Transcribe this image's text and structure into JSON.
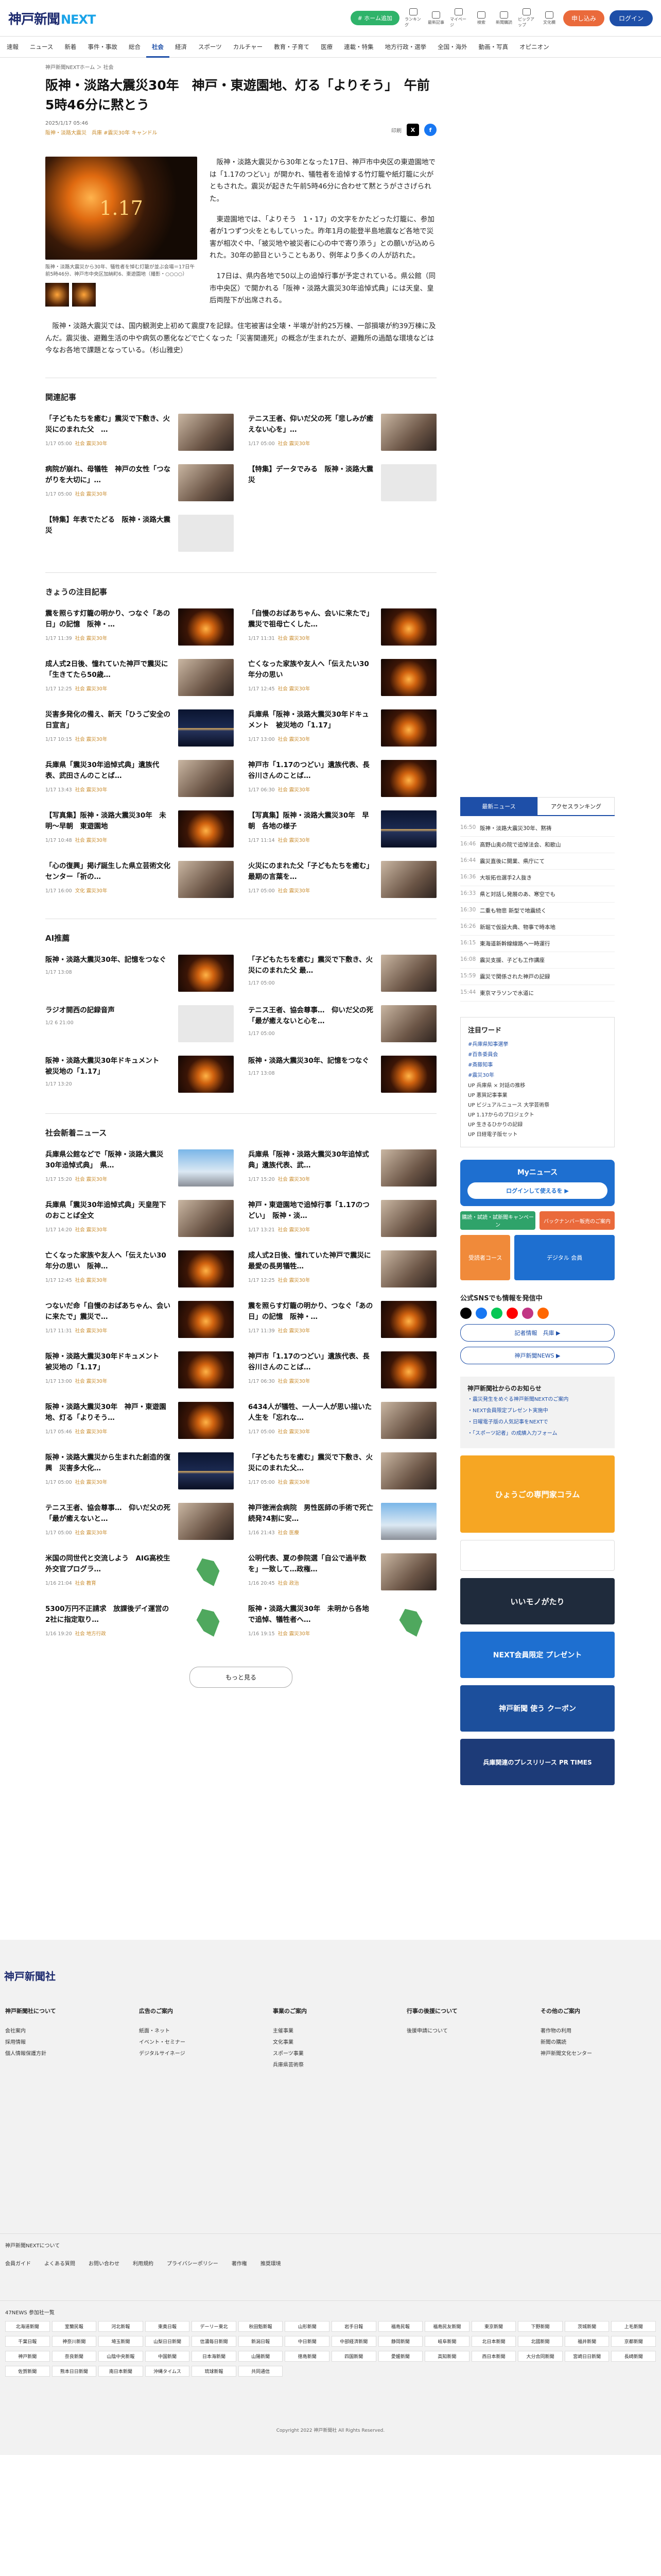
{
  "header": {
    "logo_main": "神戸新聞",
    "logo_next": "NEXT",
    "green_button": "# ホーム追加",
    "icons": [
      "ランキング",
      "最新記事",
      "マイページ"
    ],
    "icon2": [
      "検索",
      "新聞購読",
      "ピックアップ",
      "文化欄"
    ],
    "subscribe": "申し込み",
    "login": "ログイン"
  },
  "nav": [
    "速報",
    "ニュース",
    "新着",
    "事件・事故",
    "総合",
    "社会",
    "経済",
    "スポーツ",
    "カルチャー",
    "教育・子育て",
    "医療",
    "連載・特集",
    "地方行政・選挙",
    "全国・海外",
    "動画・写真",
    "オピニオン"
  ],
  "nav_active": "社会",
  "breadcrumb": "神戸新聞NEXTホーム ＞ 社会",
  "article": {
    "title": "阪神・淡路大震災30年　神戸・東遊園地、灯る「よりそう」　午前5時46分に黙とう",
    "date": "2025/1/17 05:46",
    "tags": "阪神・淡路大震災　兵庫 #震災30年 キャンドル",
    "print": "印刷",
    "caption": "阪神・淡路大震災から30年、犠牲者を悼む灯籠が並ぶ会場＝17日午前5時46分、神戸市中央区加納町6、東遊園地（撮影・○○○○）",
    "paras": [
      "阪神・淡路大震災から30年となった17日、神戸市中央区の東遊園地では「1.17のつどい」が開かれ、犠牲者を追悼する竹灯籠や紙灯籠に火がともされた。震災が起きた午前5時46分に合わせて黙とうがささげられた。",
      "東遊園地では、「よりそう　1・17」の文字をかたどった灯籠に、参加者が1つずつ火をともしていった。昨年1月の能登半島地震など各地で災害が相次ぐ中、「被災地や被災者に心の中で寄り添う」との願いが込められた。30年の節目ということもあり、例年より多くの人が訪れた。",
      "17日は、県内各地で50以上の追悼行事が予定されている。県公館（同市中央区）で開かれる「阪神・淡路大震災30年追悼式典」には天皇、皇后両陛下が出席される。"
    ],
    "full": "阪神・淡路大震災では、国内観測史上初めて震度7を記録。住宅被害は全壊・半壊が計約25万棟、一部損壊が約39万棟に及んだ。震災後、避難生活の中や病気の悪化などで亡くなった「災害関連死」の概念が生まれたが、避難所の過酷な環境などは今なお各地で課題となっている。（杉山雅史）"
  },
  "related": {
    "heading": "関連記事",
    "items": [
      {
        "t": "「子どもたちを癒む」震災で下敷き、火災にのまれた父　…",
        "m": "1/17 05:00",
        "c": "社会 震災30年",
        "img": "people"
      },
      {
        "t": "テニス王者、仰いだ父の死「悲しみが癒えない心を」…",
        "m": "1/17 05:00",
        "c": "社会 震災30年",
        "img": "people"
      },
      {
        "t": "病院が崩れ、母犠牲　神戸の女性「つながりを大切に」…",
        "m": "1/17 05:00",
        "c": "社会 震災30年",
        "img": "people"
      },
      {
        "t": "【特集】データでみる　阪神・淡路大震災",
        "m": "",
        "c": "",
        "img": "grey"
      },
      {
        "t": "【特集】年表でたどる　阪神・淡路大震災",
        "m": "",
        "c": "",
        "img": "grey"
      }
    ]
  },
  "today": {
    "heading": "きょうの注目記事",
    "items": [
      {
        "t": "震を照らす灯籠の明かり、つなぐ「あの日」の記憶　阪神・…",
        "m": "1/17 11:39",
        "c": "社会 震災30年",
        "img": "fire"
      },
      {
        "t": "「自慢のおばあちゃん、会いに来たで」震災で祖母亡くした…",
        "m": "1/17 11:31",
        "c": "社会 震災30年",
        "img": "fire"
      },
      {
        "t": "",
        "m": "",
        "c": "",
        "img": ""
      },
      {
        "t": "成人式2日後、憧れていた神戸で震災に「生きてたら50歳…",
        "m": "1/17 12:25",
        "c": "社会 震災30年",
        "img": "people"
      },
      {
        "t": "亡くなった家族や友人へ「伝えたい30年分の思い",
        "m": "1/17 12:45",
        "c": "社会 震災30年",
        "img": "fire"
      },
      {
        "t": "災害多発化の備え、新天「ひうご安全の日宣言」",
        "m": "1/17 10:15",
        "c": "社会 震災30年",
        "img": "night"
      },
      {
        "t": "兵庫県「阪神・淡路大震災30年ドキュメント　被災地の「1.17」",
        "m": "1/17 13:00",
        "c": "社会 震災30年",
        "img": "fire"
      },
      {
        "t": "兵庫県「震災30年追悼式典」遺族代表、武田さんのことば…",
        "m": "1/17 13:43",
        "c": "社会 震災30年",
        "img": "people"
      },
      {
        "t": "神戸市「1.17のつどい」遺族代表、長谷川さんのことば…",
        "m": "1/17 06:30",
        "c": "社会 震災30年",
        "img": "fire"
      },
      {
        "t": "【写真集】阪神・淡路大震災30年　未明～早朝　東遊園地",
        "m": "1/17 10:48",
        "c": "社会 震災30年",
        "img": "fire"
      },
      {
        "t": "【写真集】阪神・淡路大震災30年　早朝　各地の様子",
        "m": "1/17 11:14",
        "c": "社会 震災30年",
        "img": "night"
      },
      {
        "t": "",
        "m": "",
        "c": "",
        "img": ""
      },
      {
        "t": "「心の復興」掲げ誕生した県立芸術文化センター「祈の…",
        "m": "1/17 16:00",
        "c": "文化 震災30年",
        "img": "people"
      },
      {
        "t": "火災にのまれた父「子どもたちを癒む」　最期の言葉を…",
        "m": "1/17 05:00",
        "c": "社会 震災30年",
        "img": "people"
      }
    ]
  },
  "ai": {
    "heading": "AI推薦",
    "items": [
      {
        "t": "阪神・淡路大震災30年、記憶をつなぐ",
        "m": "1/17 13:08",
        "c": "",
        "img": "fire"
      },
      {
        "t": "「子どもたちを癒む」震災で下敷き、火災にのまれた父 最…",
        "m": "1/17 05:00",
        "c": "",
        "img": "people"
      },
      {
        "t": "ラジオ開西の記録音声",
        "m": "1/2 6 21:00",
        "c": "",
        "img": "grey"
      },
      {
        "t": "テニス王者、協会尊事…　仰いだ父の死「最が癒えないと心を…",
        "m": "1/17 05:00",
        "c": "",
        "img": "people"
      },
      {
        "t": "阪神・淡路大震災30年ドキュメント　被災地の「1.17」",
        "m": "1/17 13:20",
        "c": "",
        "img": "fire"
      },
      {
        "t": "阪神・淡路大震災30年、記憶をつなぐ",
        "m": "1/17 13:08",
        "c": "",
        "img": "fire"
      }
    ]
  },
  "social": {
    "heading": "社会新着ニュース",
    "items": [
      {
        "t": "兵庫県公館などで「阪神・淡路大震災30年追悼式典」　県…",
        "m": "1/17 15:20",
        "c": "社会 震災30年",
        "img": "blue"
      },
      {
        "t": "兵庫県「阪神・淡路大震災30年追悼式典」遺族代表、武…",
        "m": "1/17 15:20",
        "c": "社会 震災30年",
        "img": "people"
      },
      {
        "t": "",
        "m": "",
        "c": "",
        "img": ""
      },
      {
        "t": "兵庫県「震災30年追悼式典」天皇陛下のおことば全文",
        "m": "1/17 14:20",
        "c": "社会 震災30年",
        "img": "people"
      },
      {
        "t": "神戸・東遊園地で追悼行事「1.17のつどい」　阪神・淡…",
        "m": "1/17 13:21",
        "c": "社会 震災30年",
        "img": "people"
      },
      {
        "t": "亡くなった家族や友人へ「伝えたい30年分の思い　阪神…",
        "m": "1/17 12:45",
        "c": "社会 震災30年",
        "img": "fire"
      },
      {
        "t": "成人式2日後、憧れていた神戸で震災に　最愛の長男犠牲…",
        "m": "1/17 12:25",
        "c": "社会 震災30年",
        "img": "people"
      },
      {
        "t": "つないだ命「自慢のおばあちゃん、会いに来たで」震災で…",
        "m": "1/17 11:31",
        "c": "社会 震災30年",
        "img": "fire"
      },
      {
        "t": "震を照らす灯籠の明かり、つなぐ「あの日」の記憶　阪神・…",
        "m": "1/17 11:39",
        "c": "社会 震災30年",
        "img": "fire"
      },
      {
        "t": "",
        "m": "",
        "c": "",
        "img": ""
      },
      {
        "t": "阪神・淡路大震災30年ドキュメント　被災地の「1.17」",
        "m": "1/17 13:00",
        "c": "社会 震災30年",
        "img": "fire"
      },
      {
        "t": "神戸市「1.17のつどい」遺族代表、長谷川さんのことば…",
        "m": "1/17 06:30",
        "c": "社会 震災30年",
        "img": "fire"
      },
      {
        "t": "阪神・淡路大震災30年　神戸・東遊園地、灯る「よりそう…",
        "m": "1/17 05:46",
        "c": "社会 震災30年",
        "img": "fire"
      },
      {
        "t": "6434人が犠牲、一人一人が思い描いた人生を「忘れな…",
        "m": "1/17 05:00",
        "c": "社会 震災30年",
        "img": "people"
      },
      {
        "t": "",
        "m": "",
        "c": "",
        "img": ""
      },
      {
        "t": "阪神・淡路大震災から生まれた創造的復興　災害多大化…",
        "m": "1/17 05:00",
        "c": "社会 震災30年",
        "img": "night"
      },
      {
        "t": "「子どもたちを癒む」震災で下敷き、火災にのまれた父…",
        "m": "1/17 05:00",
        "c": "社会 震災30年",
        "img": "people"
      },
      {
        "t": "テニス王者、協会尊事…　仰いだ父の死「最が癒えないと…",
        "m": "1/17 05:00",
        "c": "社会 震災30年",
        "img": "people"
      },
      {
        "t": "神戸徳洲会病院　男性医師の手術で死亡続発?4割に安…",
        "m": "1/16 21:43",
        "c": "社会 医療",
        "img": "blue"
      },
      {
        "t": "米国の同世代と交流しよう　AIG高校生外交官プログラ…",
        "m": "1/16 21:04",
        "c": "社会 教育",
        "img": "map"
      },
      {
        "t": "公明代表、夏の参院選「自公で過半数を」一致して…政権…",
        "m": "1/16 20:45",
        "c": "社会 政治",
        "img": "people"
      },
      {
        "t": "",
        "m": "",
        "c": "",
        "img": ""
      },
      {
        "t": "5300万円不正請求　放課後デイ運営の2社に指定取り…",
        "m": "1/16 19:20",
        "c": "社会 地方行政",
        "img": "map"
      },
      {
        "t": "阪神・淡路大震災30年　未明から各地で追悼、犠牲者へ…",
        "m": "1/16 19:15",
        "c": "社会 震災30年",
        "img": "map"
      }
    ]
  },
  "more_button": "もっと見る",
  "sidebar": {
    "tabs": [
      "最新ニュース",
      "アクセスランキング"
    ],
    "rank": [
      {
        "time": "16:50",
        "t": "阪神・淡路大震災30年、黙祷"
      },
      {
        "time": "16:46",
        "t": "高野山奥の院で追悼法会、和歌山"
      },
      {
        "time": "16:44",
        "t": "震災直後に開業、県庁にて"
      },
      {
        "time": "16:36",
        "t": "大坂拓也選手2人抜き"
      },
      {
        "time": "16:33",
        "t": "県と対話し発展のあ、寒空でも"
      },
      {
        "time": "16:30",
        "t": "二重も物悲 新型で地震続く"
      },
      {
        "time": "16:26",
        "t": "新堀で仮設大典、物事で時本地"
      },
      {
        "time": "16:15",
        "t": "東海道新幹線線路へ一時運行"
      },
      {
        "time": "16:08",
        "t": "震災支援、子ども工作講座"
      },
      {
        "time": "15:59",
        "t": "震災で関係された神戸の記録"
      },
      {
        "time": "15:44",
        "t": "東京マラソンで水道に"
      }
    ],
    "watch_heading": "注目ワード",
    "watch": [
      "#兵庫県知事選挙",
      "#百条委員会",
      "#斎藤知事",
      "#震災30年"
    ],
    "updates": [
      "UP 兵庫県 × 対話の推移",
      "UP 悪質記事事業",
      "UP ビジュアルニュース 大学芸術祭",
      "UP 1.17からのプロジェクト",
      "UP 生きるひかりの記録",
      "UP 日経電子版セット"
    ],
    "my_title": "Myニュース",
    "my_btn": "ログインして使えるを ▶",
    "pair": [
      "購読・試読・試新聞キャンペーン",
      "バックナンバー販売のご案内"
    ],
    "promo1": "デジタル 会員",
    "promo2": "受読者コース",
    "sns_h": "公式SNSでも情報を発信中",
    "sns_btn1": "記者情報　兵庫 ▶",
    "sns_btn2": "神戸新聞NEWS ▶",
    "ann_h": "神戸新聞社からのお知らせ",
    "ann": [
      "・震災発生をめぐる神戸新聞NEXTのご案内",
      "・NEXT会員限定プレゼント実施中",
      "・日曜電子版の人気記事をNEXTで",
      "・「スポーツ記者」の成績入力フォーム"
    ],
    "col_h": "ひょうごの専門家コラム",
    "b1": "いいモノがたり",
    "b2": "NEXT会員限定 プレゼント",
    "b3": "神戸新聞 使う クーポン",
    "b4": "兵庫関連のプレスリリース PR TIMES"
  },
  "footer": {
    "company": "神戸新聞社",
    "cols": [
      {
        "h": "神戸新聞社について",
        "items": [
          "会社案内",
          "採用情報",
          "個人情報保護方針"
        ]
      },
      {
        "h": "広告のご案内",
        "items": [
          "紙面・ネット",
          "イベント・セミナー",
          "デジタルサイネージ"
        ]
      },
      {
        "h": "事業のご案内",
        "items": [
          "主催事業",
          "文化事業",
          "スポーツ事業",
          "兵庫県芸術祭"
        ]
      },
      {
        "h": "行事の後援について",
        "items": [
          "後援申請について"
        ]
      },
      {
        "h": "その他のご案内",
        "items": [
          "著作物の利用",
          "新聞の購読",
          "神戸新聞文化センター"
        ]
      }
    ],
    "next_h": "神戸新聞NEXTについて",
    "links": [
      "会員ガイド",
      "よくある質問",
      "お問い合わせ",
      "利用規約",
      "プライバシーポリシー",
      "著作権",
      "推奨環境"
    ],
    "n47": "47NEWS 参加社一覧",
    "papers": [
      "北海道新聞",
      "室蘭民報",
      "河北新報",
      "東奥日報",
      "デーリー東北",
      "秋田魁新報",
      "山形新聞",
      "岩手日報",
      "福島民報",
      "福島民友新聞",
      "東京新聞",
      "下野新聞",
      "茨城新聞",
      "上毛新聞",
      "千葉日報",
      "神奈川新聞",
      "埼玉新聞",
      "山梨日日新聞",
      "信濃毎日新聞",
      "新潟日報",
      "中日新聞",
      "中部経済新聞",
      "静岡新聞",
      "岐阜新聞",
      "北日本新聞",
      "北國新聞",
      "福井新聞",
      "京都新聞",
      "神戸新聞",
      "奈良新聞",
      "山陰中央新報",
      "中国新聞",
      "日本海新聞",
      "山陽新聞",
      "徳島新聞",
      "四国新聞",
      "愛媛新聞",
      "高知新聞",
      "西日本新聞",
      "大分合同新聞",
      "宮崎日日新聞",
      "長崎新聞",
      "佐賀新聞",
      "熊本日日新聞",
      "南日本新聞",
      "沖縄タイムス",
      "琉球新報",
      "共同通信"
    ],
    "copy": "Copyright 2022 神戸新聞社 All Rights Reserved."
  }
}
